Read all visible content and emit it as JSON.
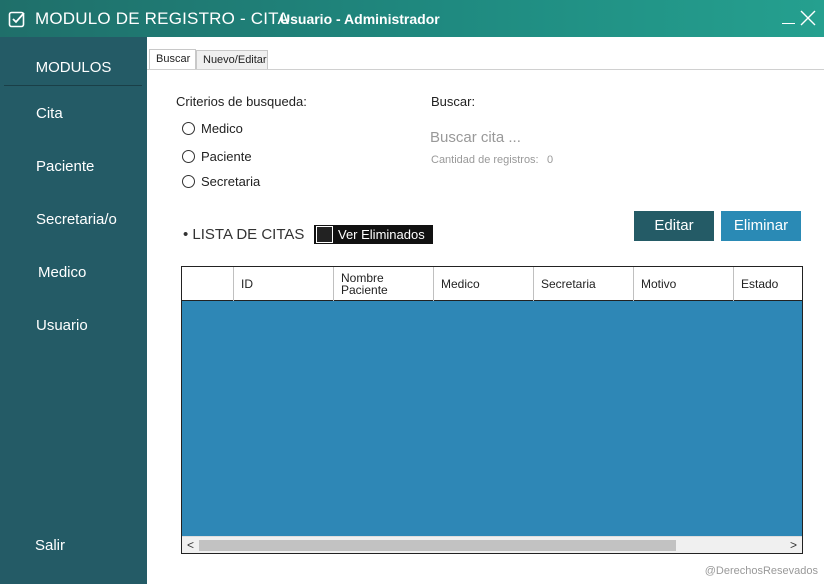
{
  "window": {
    "title": "MODULO DE REGISTRO - CITA",
    "user": "Usuario - Administrador",
    "icons": [
      "checkbox-icon",
      "minimize-icon",
      "close-icon"
    ]
  },
  "sidebar": {
    "header": "MODULOS",
    "items": [
      {
        "label": "Cita"
      },
      {
        "label": "Paciente"
      },
      {
        "label": "Secretaria/o"
      },
      {
        "label": "Medico"
      },
      {
        "label": "Usuario"
      },
      {
        "label": "Salir"
      }
    ]
  },
  "tabs": [
    {
      "label": "Buscar",
      "active": true
    },
    {
      "label": "Nuevo/Editar",
      "active": false
    }
  ],
  "search": {
    "criteria_label": "Criterios de busqueda:",
    "options": [
      "Medico",
      "Paciente",
      "Secretaria"
    ],
    "buscar_label": "Buscar:",
    "placeholder": "Buscar cita ...",
    "count_label": "Cantidad de registros:",
    "count_value": "0"
  },
  "list": {
    "title": "• LISTA DE CITAS",
    "show_deleted": "Ver Eliminados",
    "edit_button": "Editar",
    "delete_button": "Eliminar",
    "columns": [
      "",
      "ID",
      "Nombre\nPaciente",
      "Medico",
      "Secretaria",
      "Motivo",
      "Estado"
    ]
  },
  "footer": "@DerechosResevados",
  "colors": {
    "sidebar": "#245b66",
    "titlebar": "#1f8a80",
    "grid_background": "#2e87b6",
    "edit_button": "#245b66",
    "delete_button": "#2a8ab5"
  }
}
